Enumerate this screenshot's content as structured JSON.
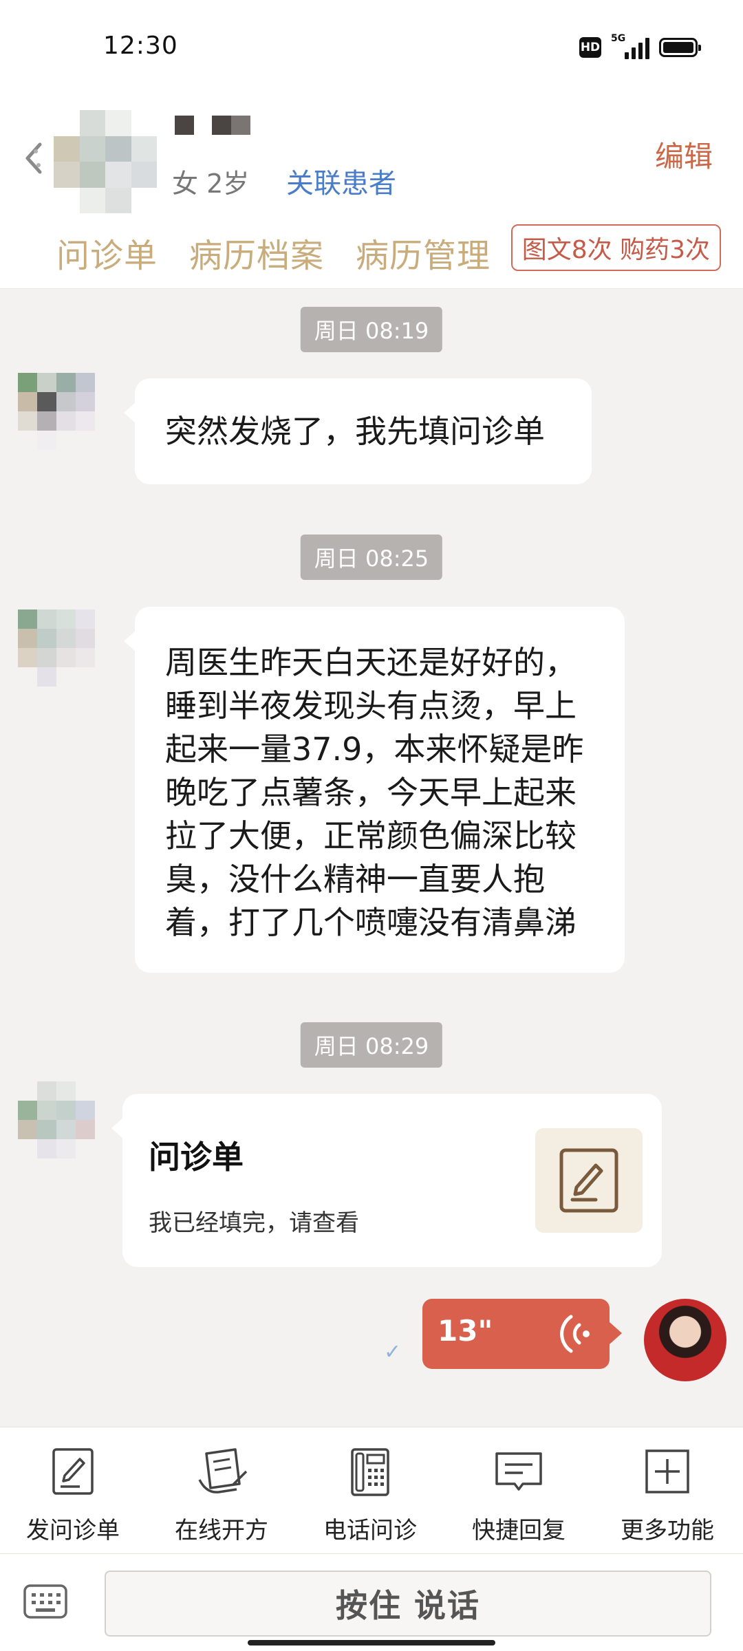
{
  "status_bar": {
    "time": "12:30",
    "network": "5G"
  },
  "header": {
    "meta": "女 2岁",
    "link_label": "关联患者",
    "edit_label": "编辑",
    "tabs": [
      {
        "label": "问诊单"
      },
      {
        "label": "病历档案"
      },
      {
        "label": "病历管理"
      }
    ],
    "stats": "图文8次 购药3次"
  },
  "messages": [
    {
      "time": "周日 08:19",
      "text": "突然发烧了，我先填问诊单"
    },
    {
      "time": "周日 08:25",
      "lines": [
        "周医生昨天白天还是好好的，",
        "睡到半夜发现头有点烫，早上",
        "起来一量37.9，本来怀疑是昨",
        "晚吃了点薯条，今天早上起来",
        "拉了大便，正常颜色偏深比较",
        "臭，没什么精神一直要人抱",
        "着，打了几个喷嚏没有清鼻涕"
      ]
    },
    {
      "time": "周日 08:29",
      "card_title": "问诊单",
      "card_desc": "我已经填完，请查看"
    }
  ],
  "voice": {
    "duration": "13\"",
    "read_mark": "✓"
  },
  "toolbar": [
    {
      "label": "发问诊单",
      "icon": "form-pen-icon"
    },
    {
      "label": "在线开方",
      "icon": "prescription-icon"
    },
    {
      "label": "电话问诊",
      "icon": "phone-icon"
    },
    {
      "label": "快捷回复",
      "icon": "quick-reply-icon"
    },
    {
      "label": "更多功能",
      "icon": "plus-icon"
    }
  ],
  "input": {
    "talk_label": "按住 说话"
  }
}
